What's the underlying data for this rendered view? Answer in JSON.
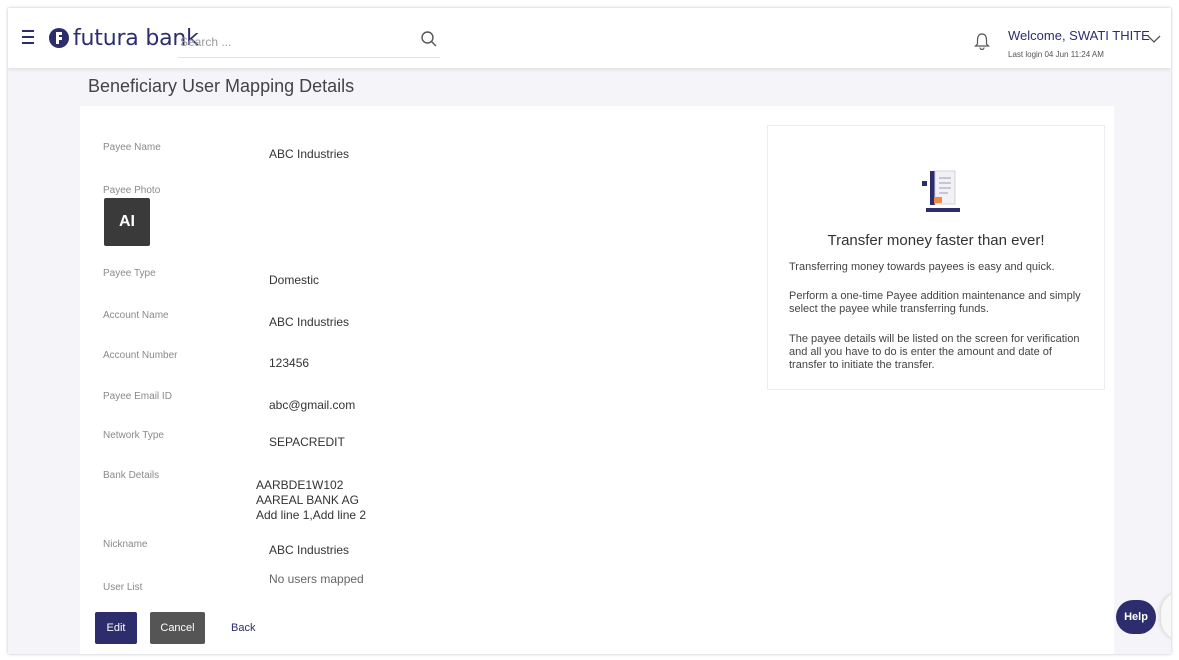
{
  "header": {
    "brand": "futura bank",
    "search_placeholder": "Search ...",
    "welcome": "Welcome, SWATI THITE",
    "last_login": "Last login 04 Jun 11:24 AM"
  },
  "page": {
    "title": "Beneficiary User Mapping Details"
  },
  "details": {
    "payee_name_label": "Payee Name",
    "payee_name": "ABC Industries",
    "payee_photo_label": "Payee Photo",
    "avatar_initials": "AI",
    "payee_type_label": "Payee Type",
    "payee_type": "Domestic",
    "account_name_label": "Account Name",
    "account_name": "ABC Industries",
    "account_number_label": "Account Number",
    "account_number": "123456",
    "email_label": "Payee Email ID",
    "email": "abc@gmail.com",
    "network_label": "Network Type",
    "network": "SEPACREDIT",
    "bank_label": "Bank Details",
    "bank_line1": "AARBDE1W102",
    "bank_line2": "AAREAL BANK AG",
    "bank_line3": "Add line 1,Add line 2",
    "nickname_label": "Nickname",
    "nickname": "ABC Industries",
    "user_list_label": "User List",
    "user_list": "No users mapped"
  },
  "info": {
    "title": "Transfer money faster than ever!",
    "para1": "Transferring money towards payees is easy and quick.",
    "para2": "Perform a one-time Payee addition maintenance and simply select the payee while transferring funds.",
    "para3": "The payee details will be listed on the screen for verification and all you have to do is enter the amount and date of transfer to initiate the transfer."
  },
  "actions": {
    "edit": "Edit",
    "cancel": "Cancel",
    "back": "Back",
    "help": "Help"
  },
  "colors": {
    "brand": "#2d2d6e",
    "cancel": "#555555",
    "background": "#f4f4f9"
  }
}
